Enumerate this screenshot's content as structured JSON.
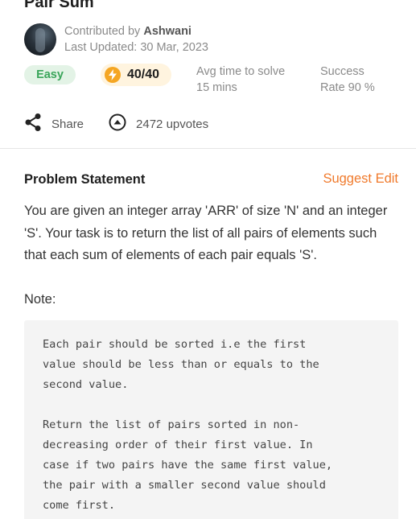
{
  "problem": {
    "title": "Pair Sum",
    "contributed_by_label": "Contributed by",
    "author": "Ashwani",
    "last_updated": "Last Updated: 30 Mar, 2023",
    "difficulty": "Easy",
    "score": "40/40",
    "avg_time_label": "Avg time to solve",
    "avg_time_value": "15 mins",
    "success_label": "Success",
    "success_value": "Rate 90 %"
  },
  "actions": {
    "share_label": "Share",
    "upvotes_label": "2472 upvotes"
  },
  "statement": {
    "heading": "Problem Statement",
    "suggest_edit": "Suggest Edit",
    "body": "You are given an integer array 'ARR' of size 'N' and an integer 'S'. Your task is to return the list of all pairs of elements such that each sum of elements of each pair equals 'S'.",
    "note_label": "Note:",
    "code": "Each pair should be sorted i.e the first\nvalue should be less than or equals to the\nsecond value.\n\nReturn the list of pairs sorted in non-\ndecreasing order of their first value. In\ncase if two pairs have the same first value,\nthe pair with a smaller second value should\ncome first."
  },
  "colors": {
    "accent_orange": "#f07a2c",
    "easy_green": "#3aa55a",
    "bolt_amber": "#f5a623"
  },
  "icons": {
    "bolt": "lightning-bolt-icon",
    "share": "share-icon",
    "upvote": "upvote-icon"
  }
}
